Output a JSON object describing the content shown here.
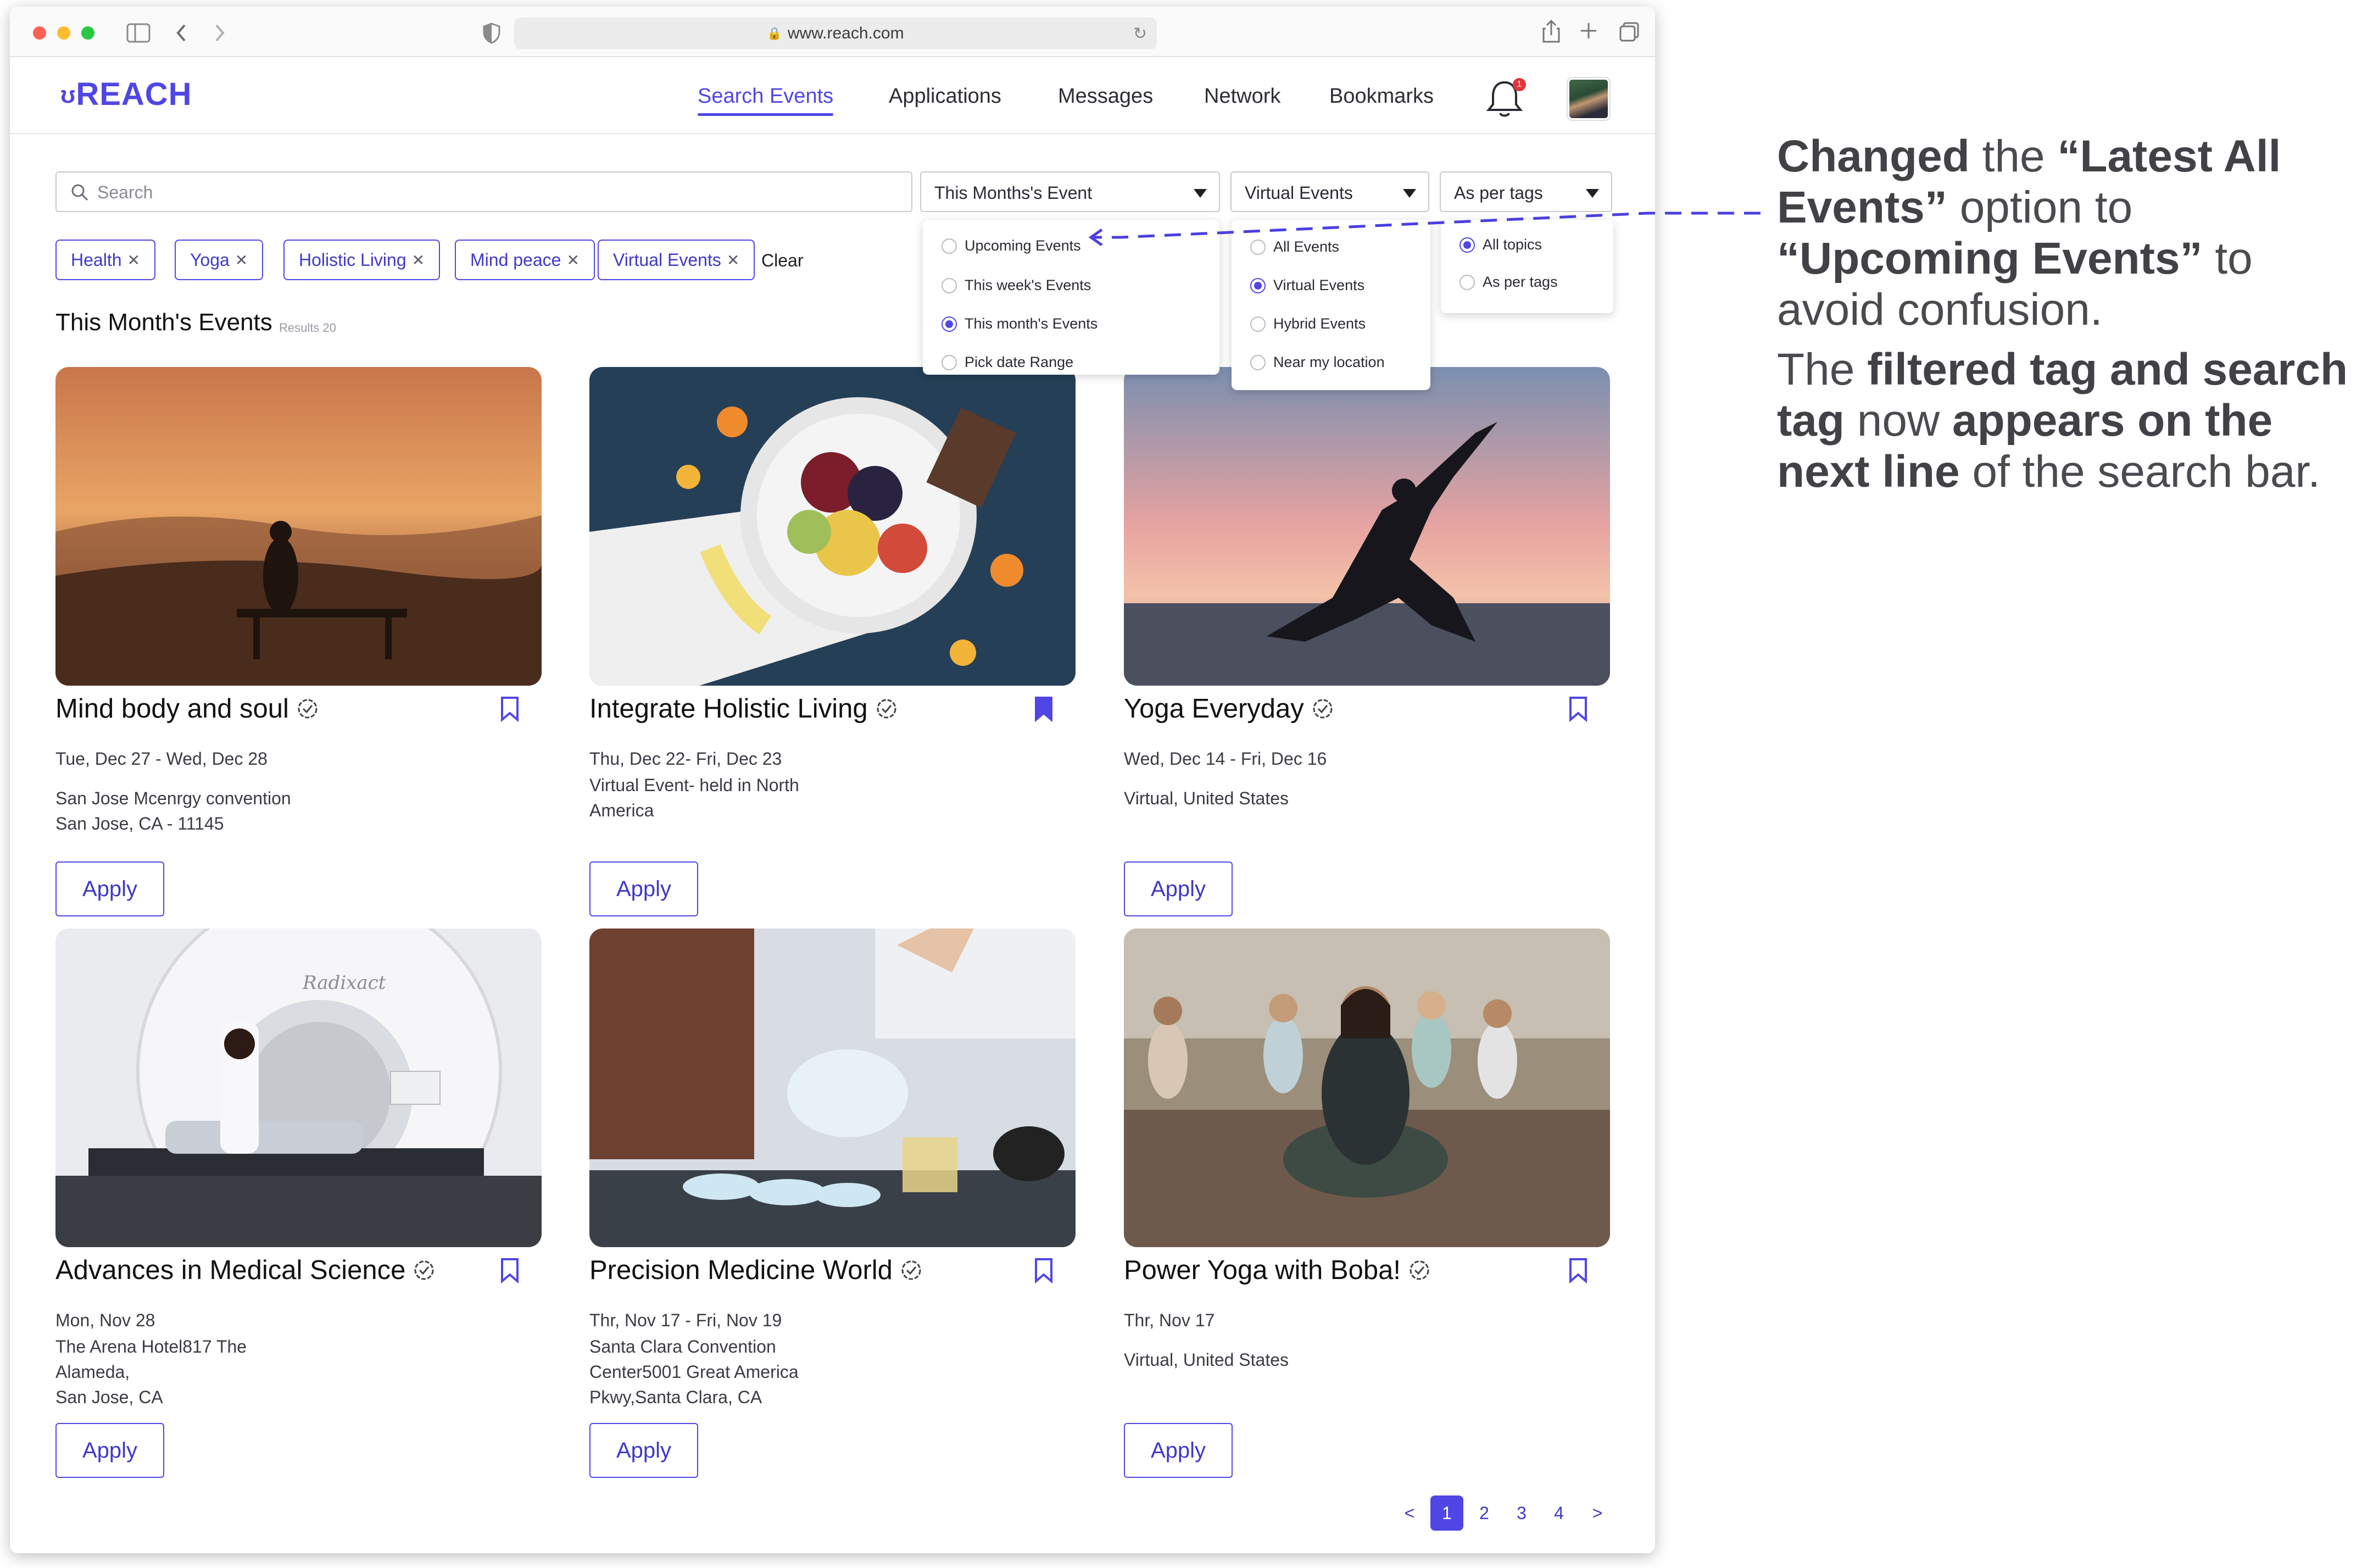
{
  "browser": {
    "url": "www.reach.com"
  },
  "app": {
    "logo": "REACH"
  },
  "nav": [
    "Search  Events",
    "Applications",
    "Messages",
    "Network",
    "Bookmarks"
  ],
  "notifications": {
    "count": "1"
  },
  "search": {
    "placeholder": "Search"
  },
  "filters": {
    "time": {
      "selected": "This Months's Event",
      "options": [
        "Upcoming Events",
        "This week's Events",
        "This month's Events",
        "Pick date Range"
      ],
      "checked": 2
    },
    "mode": {
      "selected": "Virtual Events",
      "options": [
        "All Events",
        "Virtual Events",
        "Hybrid Events",
        "Near my location"
      ],
      "checked": 1
    },
    "tags": {
      "selected": "As per tags",
      "options": [
        "All topics",
        "As per tags"
      ],
      "checked": 0
    }
  },
  "active_tags": [
    "Health",
    "Yoga",
    "Holistic Living",
    "Mind peace",
    "Virtual Events"
  ],
  "clear_label": "Clear",
  "section": {
    "title": "This Month's Events",
    "results": "Results 20"
  },
  "events": [
    {
      "title": "Mind body and soul",
      "date": "Tue, Dec 27 - Wed, Dec 28",
      "location": [
        "San Jose Mcenrgy convention",
        "San Jose, CA - 11145"
      ],
      "bookmarked": false
    },
    {
      "title": "Integrate Holistic Living",
      "date": "Thu, Dec 22- Fri, Dec 23",
      "location": [
        "Virtual Event- held in North",
        "America"
      ],
      "bookmarked": true
    },
    {
      "title": "Yoga Everyday",
      "date": "Wed, Dec 14 - Fri, Dec 16",
      "location": [
        "Virtual, United States"
      ],
      "bookmarked": false
    },
    {
      "title": "Advances in Medical Science",
      "date": "Mon, Nov 28",
      "location": [
        "The Arena Hotel817 The",
        "Alameda,",
        "San Jose, CA"
      ],
      "bookmarked": false
    },
    {
      "title": "Precision Medicine World",
      "date": "Thr, Nov 17 - Fri, Nov 19",
      "location": [
        "Santa Clara Convention",
        "Center5001 Great America",
        "Pkwy,Santa Clara, CA"
      ],
      "bookmarked": false
    },
    {
      "title": "Power Yoga with Boba!",
      "date": "Thr, Nov 17",
      "location": [
        "Virtual, United States"
      ],
      "bookmarked": false
    }
  ],
  "apply_label": "Apply",
  "photo_labels": {
    "scanner": "Radixact"
  },
  "pagination": {
    "prev": "<",
    "pages": [
      "1",
      "2",
      "3",
      "4"
    ],
    "current": "1",
    "next": ">"
  },
  "annotations": {
    "note1": [
      {
        "t": "Changed",
        "b": true
      },
      {
        "t": " the ",
        "b": false
      },
      {
        "t": "“Latest All Events”",
        "b": true
      },
      {
        "t": " option to ",
        "b": false
      },
      {
        "t": "“Upcoming Events”",
        "b": true
      },
      {
        "t": " to avoid confusion.",
        "b": false
      }
    ],
    "note2": [
      {
        "t": "The ",
        "b": false
      },
      {
        "t": "filtered tag and search tag",
        "b": true
      },
      {
        "t": " now ",
        "b": false
      },
      {
        "t": "appears on the next line",
        "b": true
      },
      {
        "t": " of the search bar.",
        "b": false
      }
    ]
  },
  "colors": {
    "accent": "#5046e5",
    "annotation_line": "#4a3fe0"
  }
}
